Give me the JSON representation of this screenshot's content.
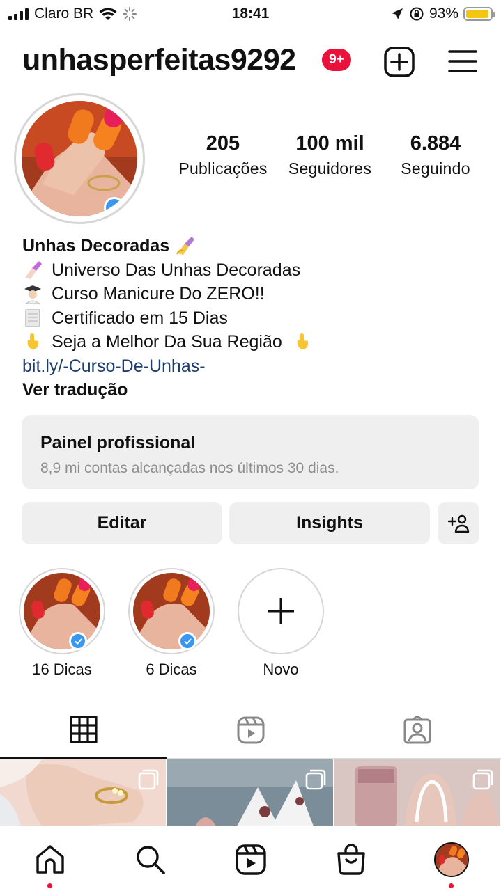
{
  "status_bar": {
    "carrier": "Claro BR",
    "time": "18:41",
    "battery": "93%",
    "battery_level": 0.93,
    "battery_color": "#f3c613",
    "icons": [
      "signal-icon",
      "wifi-icon",
      "loading-spinner-icon",
      "location-arrow-icon",
      "orientation-lock-icon",
      "battery-icon"
    ]
  },
  "header": {
    "username": "unhasperfeitas9292",
    "notification_badge": "9+",
    "icons": [
      "new-post-icon",
      "menu-icon"
    ]
  },
  "stats": {
    "posts_count": "205",
    "posts_label": "Publicações",
    "followers_count": "100 mil",
    "followers_label": "Seguidores",
    "following_count": "6.884",
    "following_label": "Seguindo"
  },
  "bio": {
    "name": "Unhas Decoradas",
    "lines": [
      {
        "emoji": "nail-polish-icon",
        "text": "Universo Das Unhas Decoradas"
      },
      {
        "emoji": "student-icon",
        "text": "Curso Manicure Do ZERO!!"
      },
      {
        "emoji": "scroll-icon",
        "text": "Certificado em 15 Dias"
      },
      {
        "emoji": "pointing-down-icon",
        "text": "Seja a Melhor Da Sua Região"
      }
    ],
    "link": "bit.ly/-Curso-De-Unhas-",
    "translate": "Ver tradução"
  },
  "panel": {
    "title": "Painel profissional",
    "subtitle": "8,9 mi contas alcançadas nos últimos 30 dias."
  },
  "buttons": {
    "edit": "Editar",
    "insights": "Insights"
  },
  "highlights": [
    {
      "label": "16 Dicas"
    },
    {
      "label": "6 Dicas"
    },
    {
      "label": "Novo"
    }
  ],
  "tabs": [
    "grid-icon",
    "reels-icon",
    "tagged-icon"
  ],
  "bottom_nav": [
    "home-icon",
    "search-icon",
    "reels-icon",
    "shop-icon",
    "profile-avatar"
  ],
  "colors": {
    "badge": "#e8123c",
    "link": "#1d3e6e",
    "verified": "#3897f0",
    "panel_bg": "#efefef"
  }
}
